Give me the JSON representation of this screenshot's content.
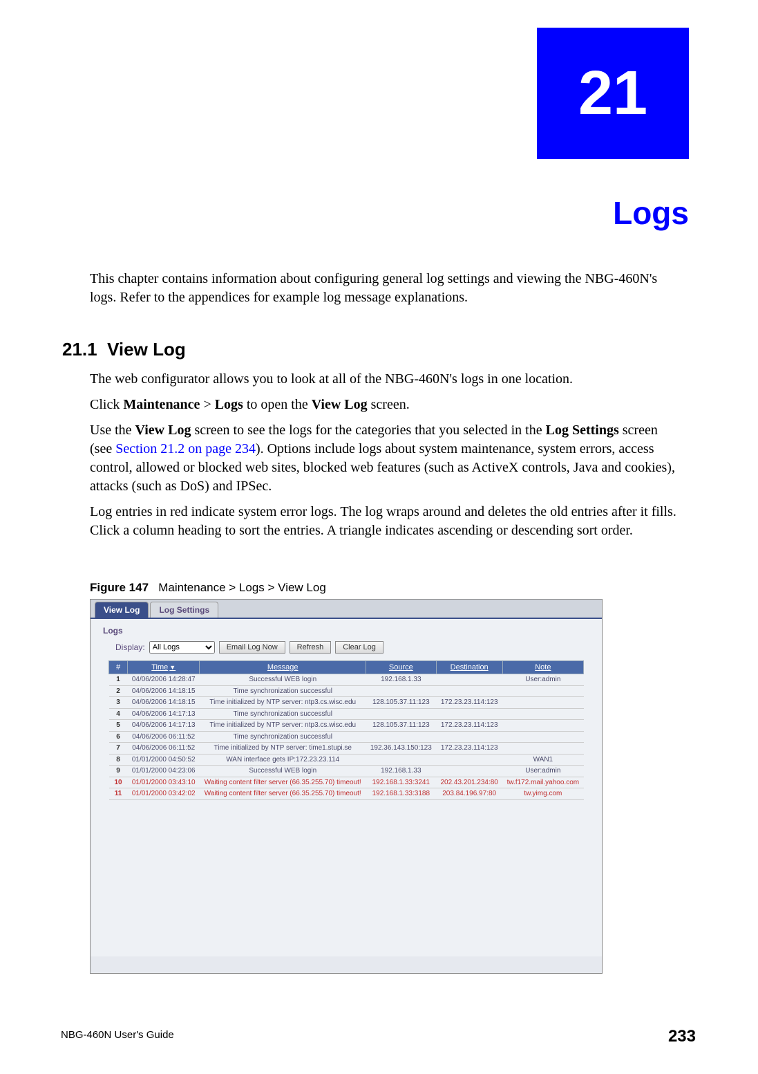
{
  "chapter_number": "21",
  "chapter_title": "Logs",
  "intro": "This chapter contains information about configuring general log settings and viewing the NBG-460N's logs. Refer to the appendices for example log message explanations.",
  "section": {
    "number": "21.1",
    "title": "View Log",
    "p1": "The web configurator allows you to look at all of the NBG-460N's logs in one location.",
    "p2_pre": "Click ",
    "p2_b1": "Maintenance",
    "p2_mid1": " > ",
    "p2_b2": "Logs",
    "p2_mid2": " to open the ",
    "p2_b3": "View Log",
    "p2_post": " screen.",
    "p3_pre": "Use the ",
    "p3_b1": "View Log",
    "p3_mid1": " screen to see the logs for the categories that you selected in the ",
    "p3_b2": "Log Settings",
    "p3_mid2": " screen (see ",
    "p3_link": "Section 21.2 on page 234",
    "p3_post": "). Options include logs about system maintenance, system errors, access control, allowed or blocked web sites, blocked web features (such as ActiveX controls, Java and cookies), attacks (such as DoS) and IPSec.",
    "p4": "Log entries in red indicate system error logs. The log wraps around and deletes the old entries after it fills. Click a column heading to sort the entries. A triangle indicates ascending or descending sort order."
  },
  "figure": {
    "label": "Figure 147",
    "caption": "Maintenance > Logs > View Log"
  },
  "ui": {
    "tab_active": "View Log",
    "tab_other": "Log Settings",
    "panel_title": "Logs",
    "display_label": "Display:",
    "display_value": "All Logs",
    "btn_email": "Email Log Now",
    "btn_refresh": "Refresh",
    "btn_clear": "Clear Log",
    "headers": {
      "idx": "#",
      "time": "Time",
      "message": "Message",
      "source": "Source",
      "destination": "Destination",
      "note": "Note"
    },
    "sort_indicator": "▼",
    "rows": [
      {
        "n": "1",
        "time": "04/06/2006 14:28:47",
        "msg": "Successful WEB login",
        "src": "192.168.1.33",
        "dst": "",
        "note": "User:admin",
        "red": false
      },
      {
        "n": "2",
        "time": "04/06/2006 14:18:15",
        "msg": "Time synchronization successful",
        "src": "",
        "dst": "",
        "note": "",
        "red": false
      },
      {
        "n": "3",
        "time": "04/06/2006 14:18:15",
        "msg": "Time initialized by NTP server: ntp3.cs.wisc.edu",
        "src": "128.105.37.11:123",
        "dst": "172.23.23.114:123",
        "note": "",
        "red": false
      },
      {
        "n": "4",
        "time": "04/06/2006 14:17:13",
        "msg": "Time synchronization successful",
        "src": "",
        "dst": "",
        "note": "",
        "red": false
      },
      {
        "n": "5",
        "time": "04/06/2006 14:17:13",
        "msg": "Time initialized by NTP server: ntp3.cs.wisc.edu",
        "src": "128.105.37.11:123",
        "dst": "172.23.23.114:123",
        "note": "",
        "red": false
      },
      {
        "n": "6",
        "time": "04/06/2006 06:11:52",
        "msg": "Time synchronization successful",
        "src": "",
        "dst": "",
        "note": "",
        "red": false
      },
      {
        "n": "7",
        "time": "04/06/2006 06:11:52",
        "msg": "Time initialized by NTP server: time1.stupi.se",
        "src": "192.36.143.150:123",
        "dst": "172.23.23.114:123",
        "note": "",
        "red": false
      },
      {
        "n": "8",
        "time": "01/01/2000 04:50:52",
        "msg": "WAN interface gets IP:172.23.23.114",
        "src": "",
        "dst": "",
        "note": "WAN1",
        "red": false
      },
      {
        "n": "9",
        "time": "01/01/2000 04:23:06",
        "msg": "Successful WEB login",
        "src": "192.168.1.33",
        "dst": "",
        "note": "User:admin",
        "red": false
      },
      {
        "n": "10",
        "time": "01/01/2000 03:43:10",
        "msg": "Waiting content filter server (66.35.255.70) timeout!",
        "src": "192.168.1.33:3241",
        "dst": "202.43.201.234:80",
        "note": "tw.f172.mail.yahoo.com",
        "red": true
      },
      {
        "n": "11",
        "time": "01/01/2000 03:42:02",
        "msg": "Waiting content filter server (66.35.255.70) timeout!",
        "src": "192.168.1.33:3188",
        "dst": "203.84.196.97:80",
        "note": "tw.yimg.com",
        "red": true
      }
    ]
  },
  "footer": {
    "guide": "NBG-460N User's Guide",
    "page": "233"
  }
}
